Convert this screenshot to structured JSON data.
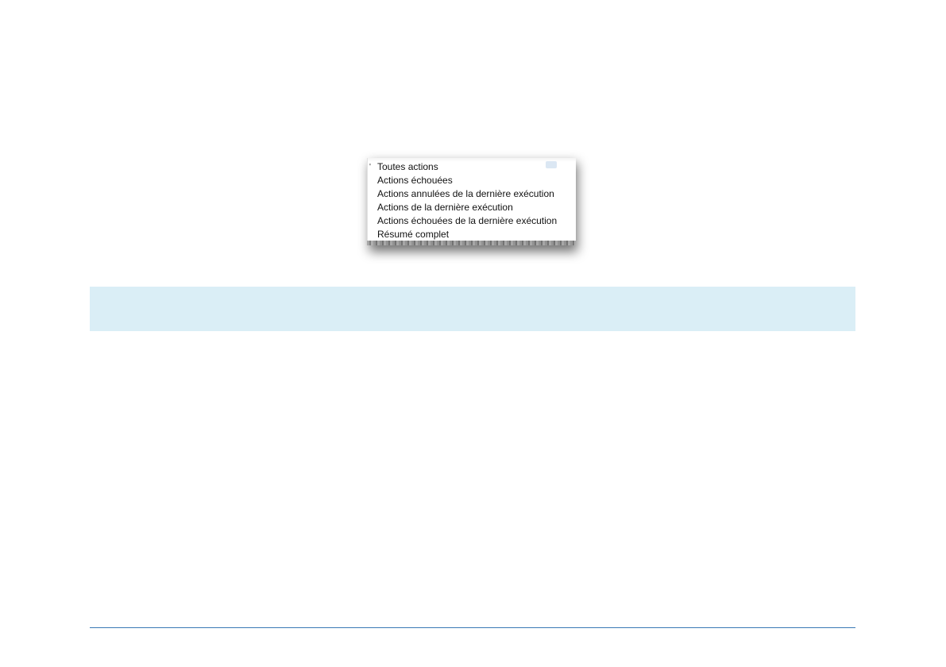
{
  "menu": {
    "items": [
      {
        "label": "Toutes actions",
        "checked": true
      },
      {
        "label": "Actions échouées",
        "checked": false
      },
      {
        "label": "Actions annulées de la dernière exécution",
        "checked": false
      },
      {
        "label": "Actions de la dernière exécution",
        "checked": false
      },
      {
        "label": "Actions échouées de la dernière exécution",
        "checked": false
      },
      {
        "label": "Résumé complet",
        "checked": false
      }
    ]
  },
  "colors": {
    "info_band": "#daeef6",
    "footer_rule": "#3a78b5"
  }
}
